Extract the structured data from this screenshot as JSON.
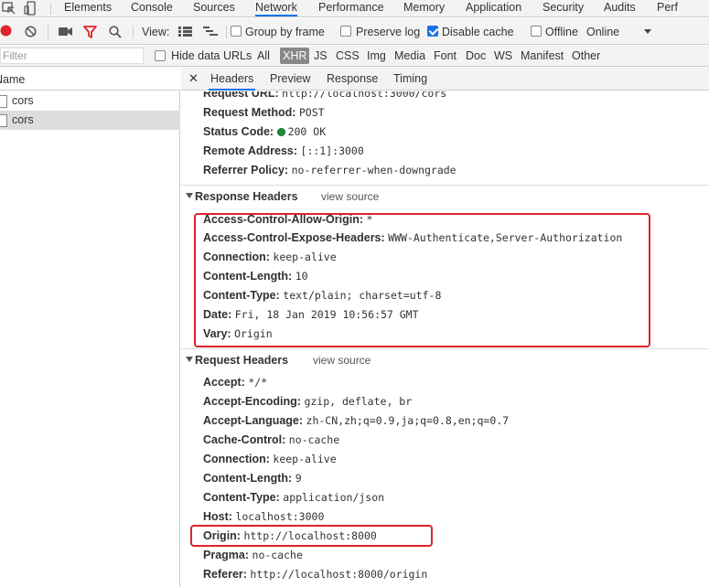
{
  "top_tabs": [
    "Elements",
    "Console",
    "Sources",
    "Network",
    "Performance",
    "Memory",
    "Application",
    "Security",
    "Audits",
    "Perf"
  ],
  "toolbar": {
    "view_label": "View:",
    "group_by_frame": "Group by frame",
    "preserve_log": "Preserve log",
    "disable_cache": "Disable cache",
    "offline": "Offline",
    "throttle": "Online"
  },
  "filter": {
    "placeholder": "Filter",
    "hide_data_urls": "Hide data URLs",
    "types": [
      "All",
      "XHR",
      "JS",
      "CSS",
      "Img",
      "Media",
      "Font",
      "Doc",
      "WS",
      "Manifest",
      "Other"
    ]
  },
  "requests": {
    "column": "Name",
    "rows": [
      "cors",
      "cors"
    ]
  },
  "detail_tabs": [
    "Headers",
    "Preview",
    "Response",
    "Timing"
  ],
  "general": [
    {
      "k": "Request URL:",
      "v": "http://localhost:3000/cors"
    },
    {
      "k": "Request Method:",
      "v": "POST"
    },
    {
      "k": "Status Code:",
      "v": "200 OK"
    },
    {
      "k": "Remote Address:",
      "v": "[::1]:3000"
    },
    {
      "k": "Referrer Policy:",
      "v": "no-referrer-when-downgrade"
    }
  ],
  "response_headers": {
    "title": "Response Headers",
    "view_source": "view source",
    "rows": [
      {
        "k": "Access-Control-Allow-Origin:",
        "v": "*"
      },
      {
        "k": "Access-Control-Expose-Headers:",
        "v": "WWW-Authenticate,Server-Authorization"
      },
      {
        "k": "Connection:",
        "v": "keep-alive"
      },
      {
        "k": "Content-Length:",
        "v": "10"
      },
      {
        "k": "Content-Type:",
        "v": "text/plain; charset=utf-8"
      },
      {
        "k": "Date:",
        "v": "Fri, 18 Jan 2019 10:56:57 GMT"
      },
      {
        "k": "Vary:",
        "v": "Origin"
      }
    ]
  },
  "request_headers": {
    "title": "Request Headers",
    "view_source": "view source",
    "rows": [
      {
        "k": "Accept:",
        "v": "*/*"
      },
      {
        "k": "Accept-Encoding:",
        "v": "gzip, deflate, br"
      },
      {
        "k": "Accept-Language:",
        "v": "zh-CN,zh;q=0.9,ja;q=0.8,en;q=0.7"
      },
      {
        "k": "Cache-Control:",
        "v": "no-cache"
      },
      {
        "k": "Connection:",
        "v": "keep-alive"
      },
      {
        "k": "Content-Length:",
        "v": "9"
      },
      {
        "k": "Content-Type:",
        "v": "application/json"
      },
      {
        "k": "Host:",
        "v": "localhost:3000"
      },
      {
        "k": "Origin:",
        "v": "http://localhost:8000"
      },
      {
        "k": "Pragma:",
        "v": "no-cache"
      },
      {
        "k": "Referer:",
        "v": "http://localhost:8000/origin"
      }
    ]
  },
  "colors": {
    "accent": "#1a73e8",
    "highlight": "#e0232b",
    "record": "#e0232b",
    "status_ok": "#1e8e3e"
  }
}
